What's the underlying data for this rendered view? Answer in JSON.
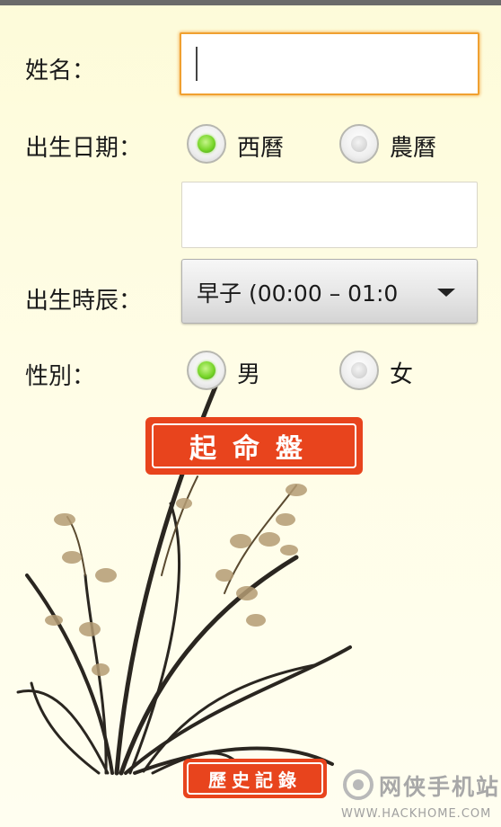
{
  "form": {
    "name_label": "姓名：",
    "name_value": "",
    "birth_date_label": "出生日期：",
    "calendar_options": [
      {
        "label": "西曆",
        "selected": true
      },
      {
        "label": "農曆",
        "selected": false
      }
    ],
    "birth_date_value": "",
    "birth_hour_label": "出生時辰：",
    "birth_hour_value": "早子 (00:00 – 01:0",
    "gender_label": "性別：",
    "gender_options": [
      {
        "label": "男",
        "selected": true
      },
      {
        "label": "女",
        "selected": false
      }
    ]
  },
  "actions": {
    "start_button_label": "起命盤",
    "history_button_label": "歷史記錄"
  },
  "watermark": {
    "brand": "网侠手机站",
    "url": "WWW.HACKHOME.COM"
  },
  "colors": {
    "accent_focus": "#f0a030",
    "stamp_red": "#e8441d",
    "radio_on": "#79d62b"
  },
  "icons": [
    "orchid-painting",
    "dropdown-arrow-icon",
    "watermark-logo-icon"
  ]
}
